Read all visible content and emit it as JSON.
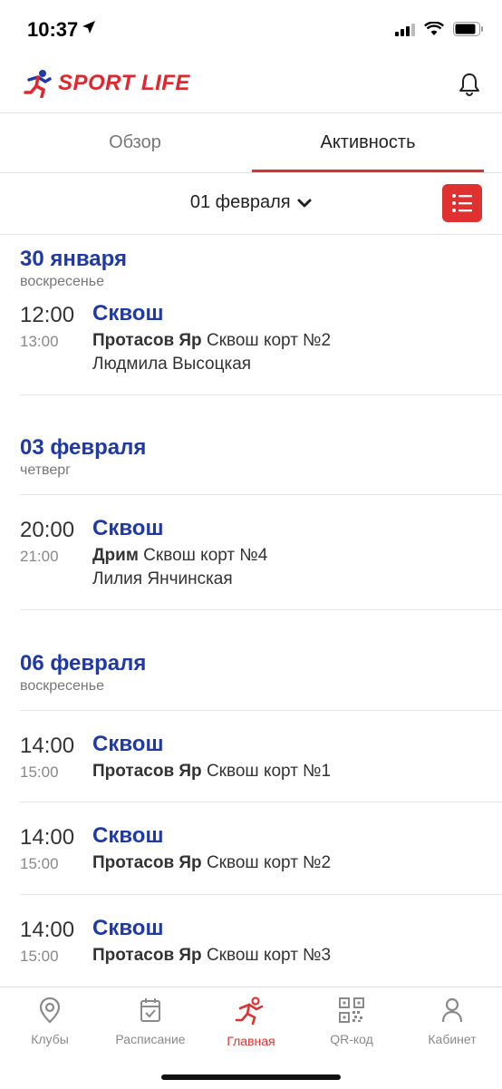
{
  "status": {
    "time": "10:37"
  },
  "header": {
    "logo_text": "SPORT LIFE"
  },
  "tabs": [
    {
      "label": "Обзор"
    },
    {
      "label": "Активность"
    }
  ],
  "date_selector": {
    "value": "01 февраля"
  },
  "days": [
    {
      "date": "30 января",
      "weekday": "воскресенье",
      "items": [
        {
          "start": "12:00",
          "end": "13:00",
          "title": "Сквош",
          "club": "Протасов Яр",
          "room": "Сквош корт №2",
          "trainer": "Людмила Высоцкая"
        }
      ]
    },
    {
      "date": "03 февраля",
      "weekday": "четверг",
      "items": [
        {
          "start": "20:00",
          "end": "21:00",
          "title": "Сквош",
          "club": "Дрим",
          "room": "Сквош корт №4",
          "trainer": "Лилия Янчинская"
        }
      ]
    },
    {
      "date": "06 февраля",
      "weekday": "воскресенье",
      "items": [
        {
          "start": "14:00",
          "end": "15:00",
          "title": "Сквош",
          "club": "Протасов Яр",
          "room": "Сквош корт №1"
        },
        {
          "start": "14:00",
          "end": "15:00",
          "title": "Сквош",
          "club": "Протасов Яр",
          "room": "Сквош корт №2"
        },
        {
          "start": "14:00",
          "end": "15:00",
          "title": "Сквош",
          "club": "Протасов Яр",
          "room": "Сквош корт №3"
        }
      ]
    }
  ],
  "tabbar": [
    {
      "label": "Клубы",
      "icon": "location-pin-icon"
    },
    {
      "label": "Расписание",
      "icon": "calendar-check-icon"
    },
    {
      "label": "Главная",
      "icon": "runner-icon",
      "active": true
    },
    {
      "label": "QR-код",
      "icon": "qr-code-icon"
    },
    {
      "label": "Кабинет",
      "icon": "user-icon"
    }
  ],
  "colors": {
    "accent_red": "#e03131",
    "title_blue": "#1f3aa8"
  }
}
